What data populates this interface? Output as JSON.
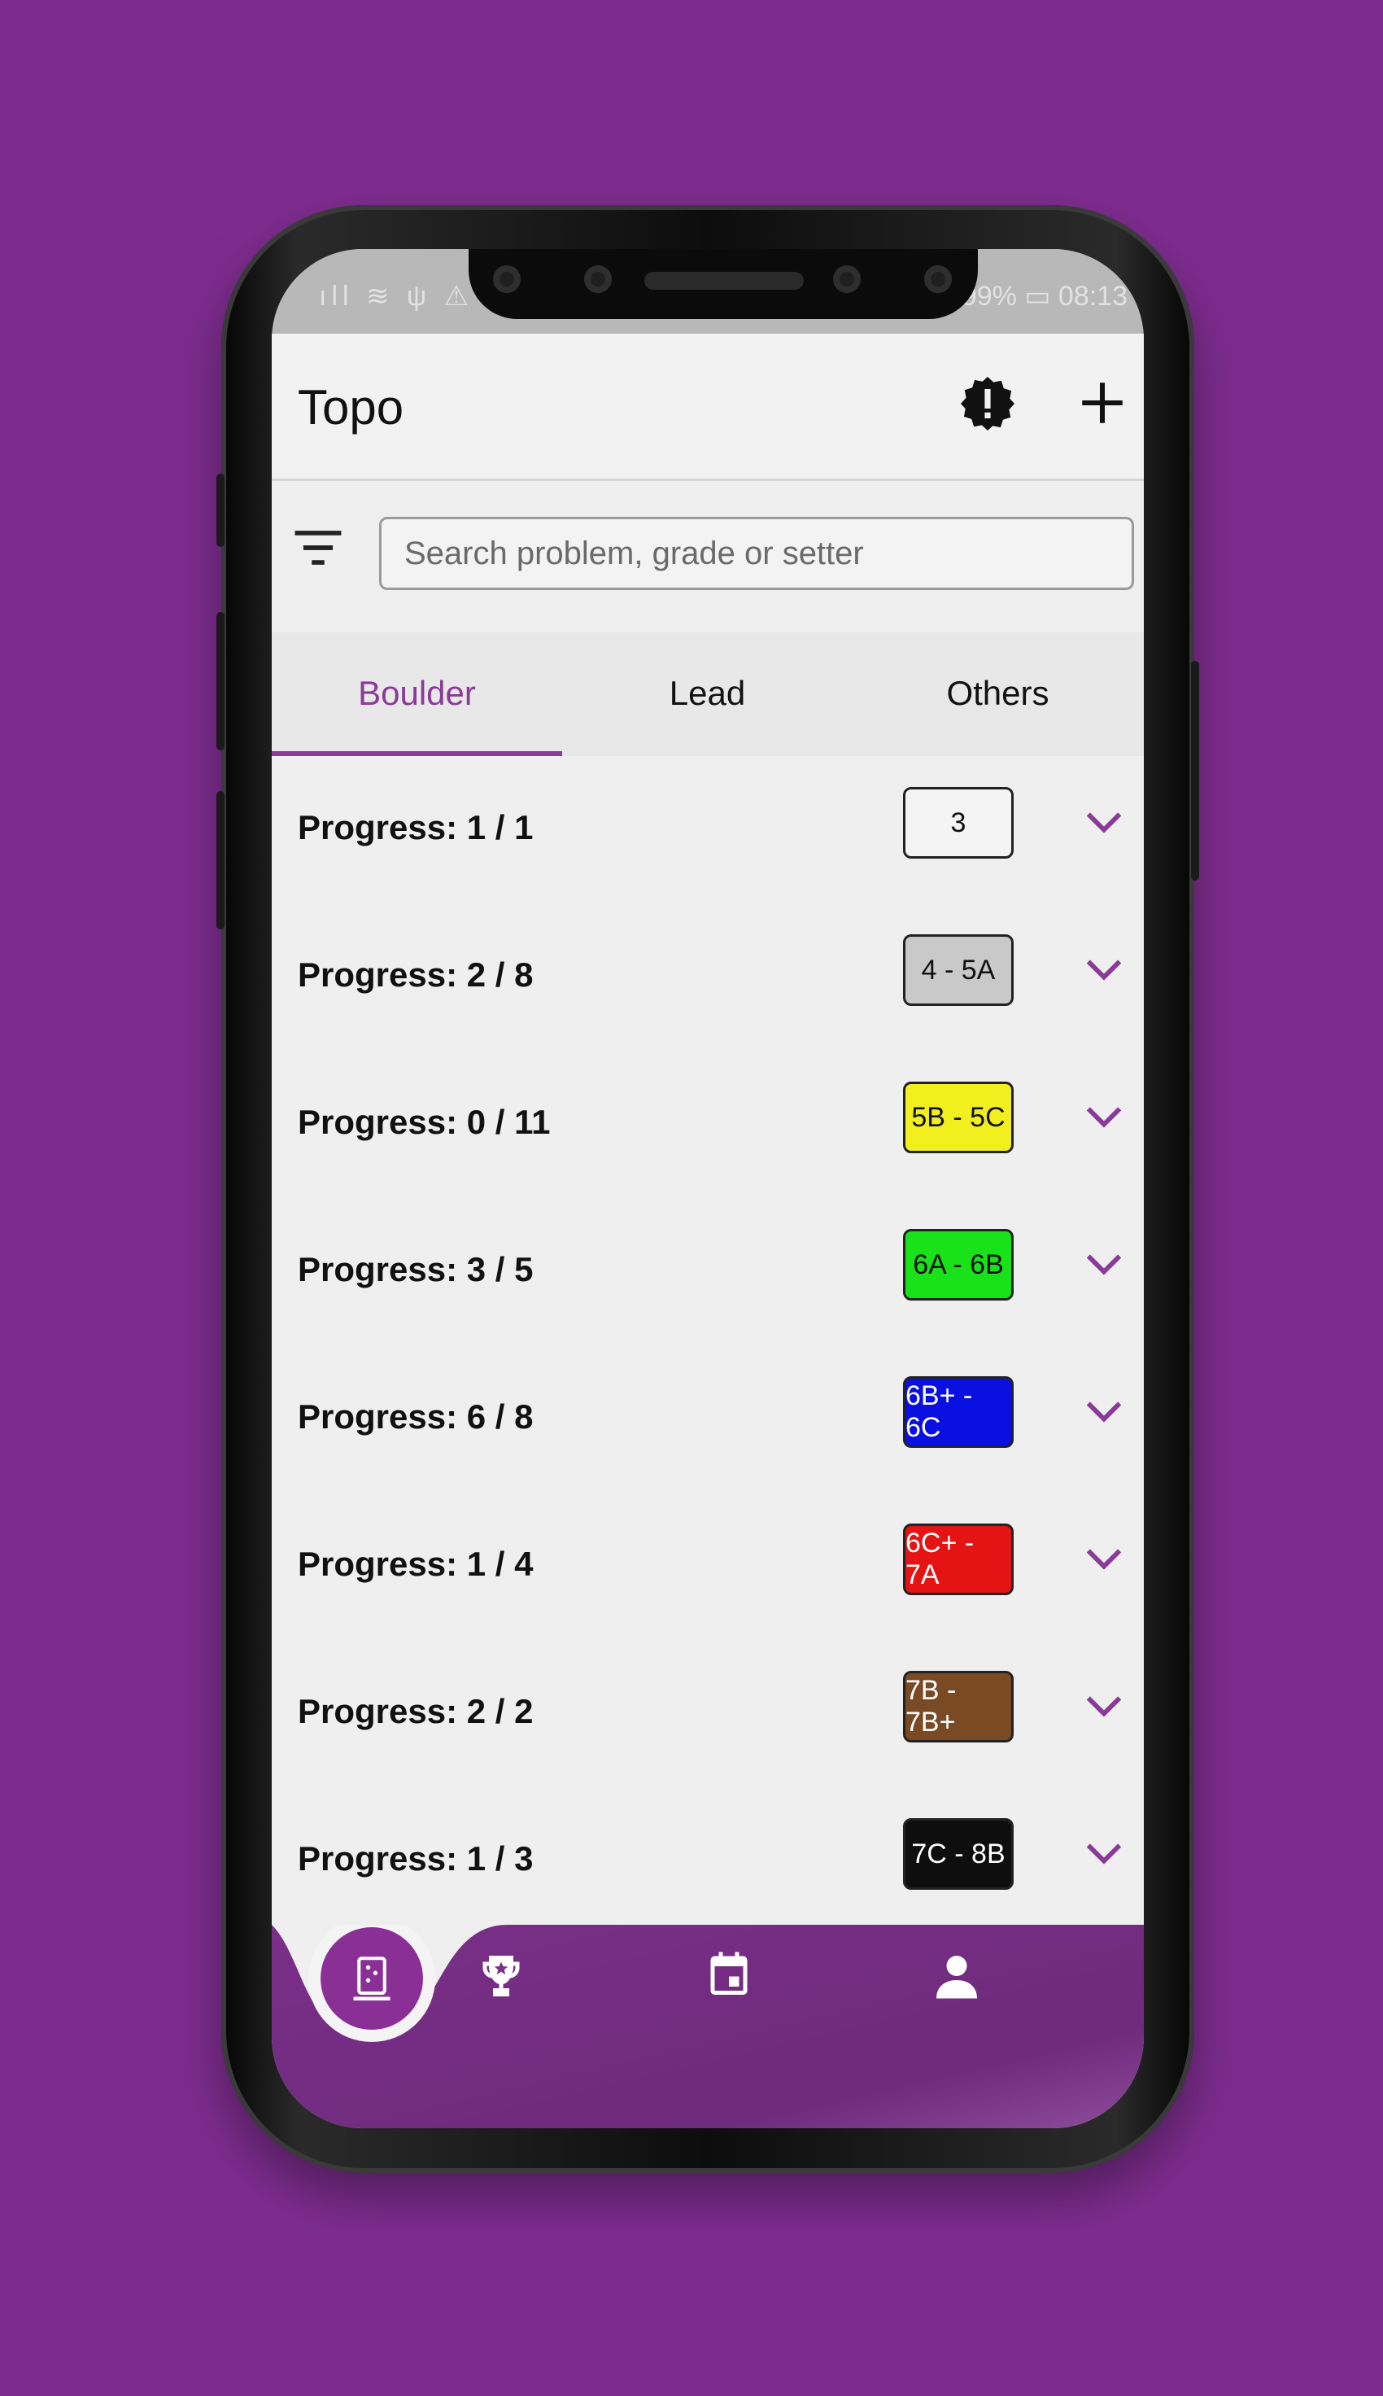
{
  "status": {
    "left_icons": "ıll ≋ ψ ⚠",
    "right_text": "99% ▭ 08:13"
  },
  "app": {
    "title": "Topo",
    "alert_icon": "alert-badge-icon",
    "add_icon": "plus-icon"
  },
  "search": {
    "filter_icon": "filter-icon",
    "placeholder": "Search problem, grade or setter",
    "value": ""
  },
  "tabs": [
    {
      "label": "Boulder",
      "active": true
    },
    {
      "label": "Lead",
      "active": false
    },
    {
      "label": "Others",
      "active": false
    }
  ],
  "rows": [
    {
      "progress": "Progress: 1 / 1",
      "grade": "3",
      "bg": "#f4f4f4",
      "fg": "#111111"
    },
    {
      "progress": "Progress: 2 / 8",
      "grade": "4 - 5A",
      "bg": "#c9c9c9",
      "fg": "#111111"
    },
    {
      "progress": "Progress: 0 / 11",
      "grade": "5B - 5C",
      "bg": "#f2ef1e",
      "fg": "#111111"
    },
    {
      "progress": "Progress: 3 / 5",
      "grade": "6A - 6B",
      "bg": "#19e21b",
      "fg": "#111111"
    },
    {
      "progress": "Progress: 6 / 8",
      "grade": "6B+ - 6C",
      "bg": "#0a10e0",
      "fg": "#ffffff"
    },
    {
      "progress": "Progress: 1 / 4",
      "grade": "6C+ - 7A",
      "bg": "#e41414",
      "fg": "#ffffff"
    },
    {
      "progress": "Progress: 2 / 2",
      "grade": "7B - 7B+",
      "bg": "#7a4a24",
      "fg": "#ffffff"
    },
    {
      "progress": "Progress: 1 / 3",
      "grade": "7C - 8B",
      "bg": "#0e0e0e",
      "fg": "#ffffff"
    }
  ],
  "nav": {
    "items": [
      "topo-icon",
      "trophy-icon",
      "calendar-icon",
      "profile-icon"
    ],
    "active_index": 0
  },
  "colors": {
    "accent": "#8a3a98",
    "background": "#7d2c8e",
    "nav_bar": "#7a2f88"
  }
}
